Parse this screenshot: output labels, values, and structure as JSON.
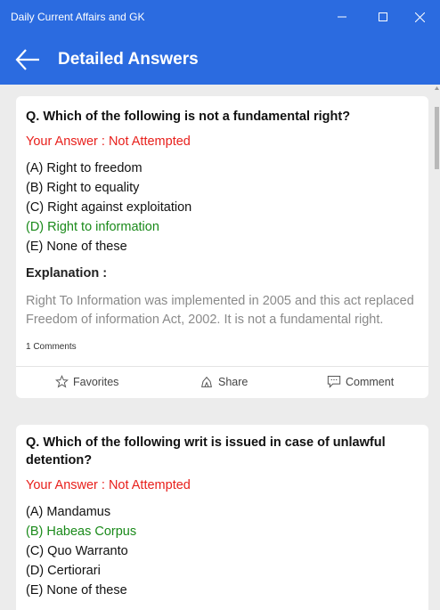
{
  "window": {
    "title": "Daily Current Affairs and GK"
  },
  "header": {
    "title": "Detailed Answers"
  },
  "questions": [
    {
      "question": "Q. Which of the following is not a fundamental right?",
      "your_answer": "Your Answer : Not Attempted",
      "options": [
        {
          "letter": "(A)",
          "text": "Right to freedom"
        },
        {
          "letter": "(B)",
          "text": "Right to equality"
        },
        {
          "letter": "(C)",
          "text": "Right against exploitation"
        },
        {
          "letter": "(D)",
          "text": "Right to information"
        },
        {
          "letter": "(E)",
          "text": "None of these"
        }
      ],
      "explanation_label": "Explanation :",
      "explanation": "Right To Information was implemented in 2005 and this act replaced Freedom of information Act, 2002. It is not a fundamental right.",
      "comments": "1 Comments",
      "actions": {
        "favorites": "Favorites",
        "share": "Share",
        "comment": "Comment"
      }
    },
    {
      "question": "Q. Which of the following writ is issued in case of unlawful detention?",
      "your_answer": "Your Answer : Not Attempted",
      "options": [
        {
          "letter": "(A)",
          "text": "Mandamus"
        },
        {
          "letter": "(B)",
          "text": "Habeas Corpus"
        },
        {
          "letter": "(C)",
          "text": "Quo Warranto"
        },
        {
          "letter": "(D)",
          "text": "Certiorari"
        },
        {
          "letter": "(E)",
          "text": "None of these"
        }
      ]
    }
  ],
  "colors": {
    "accent": "#2b6be0",
    "wrong": "#e8201c",
    "correct": "#1a8a1a"
  }
}
